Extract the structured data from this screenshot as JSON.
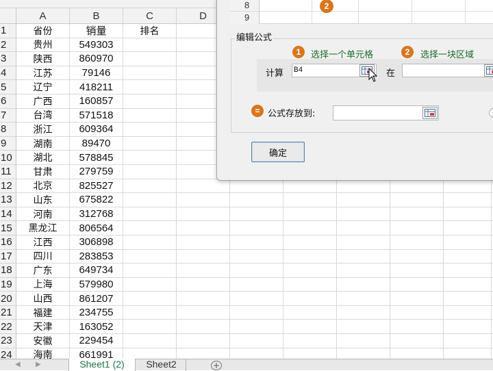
{
  "sheet": {
    "columns": [
      "A",
      "B",
      "C",
      "D"
    ],
    "rows": [
      {
        "n": "1",
        "province": "省份",
        "sales": "销量",
        "rank": "排名"
      },
      {
        "n": "2",
        "province": "贵州",
        "sales": "549303",
        "rank": ""
      },
      {
        "n": "3",
        "province": "陕西",
        "sales": "860970",
        "rank": ""
      },
      {
        "n": "4",
        "province": "江苏",
        "sales": "79146",
        "rank": ""
      },
      {
        "n": "5",
        "province": "辽宁",
        "sales": "418211",
        "rank": ""
      },
      {
        "n": "6",
        "province": "广西",
        "sales": "160857",
        "rank": ""
      },
      {
        "n": "7",
        "province": "台湾",
        "sales": "571518",
        "rank": ""
      },
      {
        "n": "8",
        "province": "浙江",
        "sales": "609364",
        "rank": ""
      },
      {
        "n": "9",
        "province": "湖南",
        "sales": "89470",
        "rank": ""
      },
      {
        "n": "10",
        "province": "湖北",
        "sales": "578845",
        "rank": ""
      },
      {
        "n": "11",
        "province": "甘肃",
        "sales": "279759",
        "rank": ""
      },
      {
        "n": "12",
        "province": "北京",
        "sales": "825527",
        "rank": ""
      },
      {
        "n": "13",
        "province": "山东",
        "sales": "675822",
        "rank": ""
      },
      {
        "n": "14",
        "province": "河南",
        "sales": "312768",
        "rank": ""
      },
      {
        "n": "15",
        "province": "黑龙江",
        "sales": "806564",
        "rank": ""
      },
      {
        "n": "16",
        "province": "江西",
        "sales": "306898",
        "rank": ""
      },
      {
        "n": "17",
        "province": "四川",
        "sales": "283853",
        "rank": ""
      },
      {
        "n": "18",
        "province": "广东",
        "sales": "649734",
        "rank": ""
      },
      {
        "n": "19",
        "province": "上海",
        "sales": "579980",
        "rank": ""
      },
      {
        "n": "20",
        "province": "山西",
        "sales": "861207",
        "rank": ""
      },
      {
        "n": "21",
        "province": "福建",
        "sales": "234755",
        "rank": ""
      },
      {
        "n": "22",
        "province": "天津",
        "sales": "163052",
        "rank": ""
      },
      {
        "n": "23",
        "province": "安徽",
        "sales": "229454",
        "rank": ""
      },
      {
        "n": "24",
        "province": "海南",
        "sales": "661991",
        "rank": ""
      }
    ]
  },
  "dialog": {
    "inner_rows": [
      "8",
      "9"
    ],
    "inner_badge": "2",
    "section_title": "编辑公式",
    "step1": {
      "num": "1",
      "label": "选择一个单元格"
    },
    "step2": {
      "num": "2",
      "label": "选择一块区域"
    },
    "calc_label": "计算",
    "calc_value": "B4",
    "in_label": "在",
    "range_value": "",
    "store_icon": "=",
    "store_label": "公式存放到:",
    "store_value": "",
    "ok_label": "确定"
  },
  "tabs": {
    "items": [
      "Sheet1 (2)",
      "Sheet2"
    ],
    "active": "Sheet1 (2)",
    "add_icon": "+"
  },
  "colors": {
    "accent": "#d9761e",
    "step_text": "#1c6b2a",
    "active_tab": "#217346"
  }
}
